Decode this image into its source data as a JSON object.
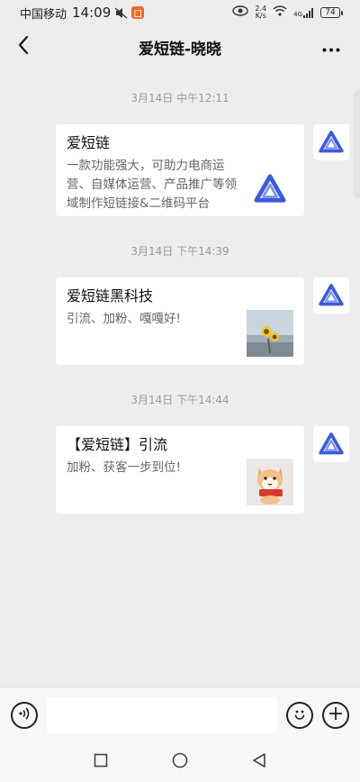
{
  "status_bar": {
    "carrier": "中国移动",
    "time": "14:09",
    "icons_left": [
      "muted-icon",
      "app-notification-icon"
    ],
    "net_speed_value": "2.4",
    "net_speed_unit": "K/s",
    "signal_label": "4G",
    "battery": "74"
  },
  "nav": {
    "title": "爱短链-晓晓",
    "back_icon": "chevron-left-icon",
    "more_icon": "more-dots-icon"
  },
  "messages": [
    {
      "timestamp": "3月14日 中午12:11",
      "title": "爱短链",
      "description": "一款功能强大，可助力电商运营、自媒体运营、产品推广等领域制作短链接&二维码平台",
      "thumb": "brand-logo"
    },
    {
      "timestamp": "3月14日 下午14:39",
      "title": "爱短链黑科技",
      "description": "引流、加粉、嘎嘎好!",
      "thumb": "sunflower-photo"
    },
    {
      "timestamp": "3月14日 下午14:44",
      "title": "【爱短链】引流",
      "description": "加粉、获客一步到位!",
      "thumb": "shiba-sticker"
    }
  ],
  "input_bar": {
    "voice_icon": "voice-icon",
    "emoji_icon": "emoji-icon",
    "plus_icon": "plus-icon",
    "input_value": ""
  },
  "system_nav": [
    "recent-apps-icon",
    "home-icon",
    "back-triangle-icon"
  ],
  "colors": {
    "background": "#ededed",
    "brand_blue": "#3e5bd8",
    "timestamp": "#9a9a9a"
  }
}
